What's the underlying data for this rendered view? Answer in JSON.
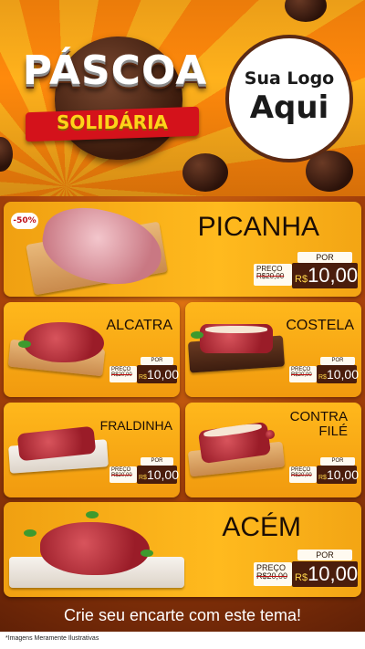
{
  "header": {
    "title": "PÁSCOA",
    "banner": "SOLIDÁRIA",
    "logo_line1": "Sua Logo",
    "logo_line2": "Aqui"
  },
  "products": [
    {
      "name": "PICANHA",
      "por_label": "POR",
      "preco_label": "PREÇO",
      "old_price": "R$20,00",
      "currency": "R$",
      "price": "10,00",
      "discount": "-50%"
    },
    {
      "name": "ALCATRA",
      "por_label": "POR",
      "preco_label": "PREÇO",
      "old_price": "R$20,00",
      "currency": "R$",
      "price": "10,00"
    },
    {
      "name": "COSTELA",
      "por_label": "POR",
      "preco_label": "PREÇO",
      "old_price": "R$20,00",
      "currency": "R$",
      "price": "10,00"
    },
    {
      "name": "FRALDINHA",
      "por_label": "POR",
      "preco_label": "PREÇO",
      "old_price": "R$20,00",
      "currency": "R$",
      "price": "10,00"
    },
    {
      "name_line1": "CONTRA",
      "name_line2": "FILÉ",
      "por_label": "POR",
      "preco_label": "PREÇO",
      "old_price": "R$20,00",
      "currency": "R$",
      "price": "10,00"
    },
    {
      "name": "ACÉM",
      "por_label": "POR",
      "preco_label": "PREÇO",
      "old_price": "R$20,00",
      "currency": "R$",
      "price": "10,00"
    }
  ],
  "cta": "Crie seu encarte com este tema!",
  "footer": "*Imagens Meramente Ilustrativas"
}
